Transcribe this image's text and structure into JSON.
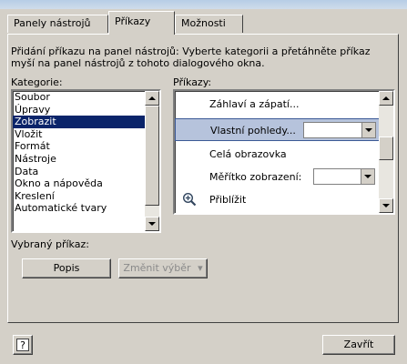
{
  "tabs": [
    {
      "label": "Panely nástrojů"
    },
    {
      "label": "Příkazy"
    },
    {
      "label": "Možnosti"
    }
  ],
  "description": "Přidání příkazu na panel nástrojů: Vyberte kategorii a přetáhněte příkaz myší na panel nástrojů z tohoto dialogového okna.",
  "categories_label": "Kategorie:",
  "commands_label": "Příkazy:",
  "categories": [
    "Soubor",
    "Úpravy",
    "Zobrazit",
    "Vložit",
    "Formát",
    "Nástroje",
    "Data",
    "Okno a nápověda",
    "Kreslení",
    "Automatické tvary"
  ],
  "selected_category": "Zobrazit",
  "commands": [
    {
      "label": "Záhlaví a zápatí...",
      "icon": "none",
      "control": "none"
    },
    {
      "label": "Vlastní pohledy...",
      "icon": "none",
      "control": "combo",
      "selected": true
    },
    {
      "label": "Celá obrazovka",
      "icon": "none",
      "control": "none"
    },
    {
      "label": "Měřítko zobrazení:",
      "icon": "none",
      "control": "combo"
    },
    {
      "label": "Přiblížit",
      "icon": "zoom-in-icon",
      "control": "none"
    }
  ],
  "selected_command_label": "Vybraný příkaz:",
  "buttons": {
    "describe": "Popis",
    "modify_selection": "Změnit výběr",
    "close": "Zavřít",
    "help_icon": "help-icon"
  },
  "colors": {
    "selection": "#0a246a",
    "command_highlight": "#b6c3dc",
    "dialog_face": "#d4d0c8"
  }
}
